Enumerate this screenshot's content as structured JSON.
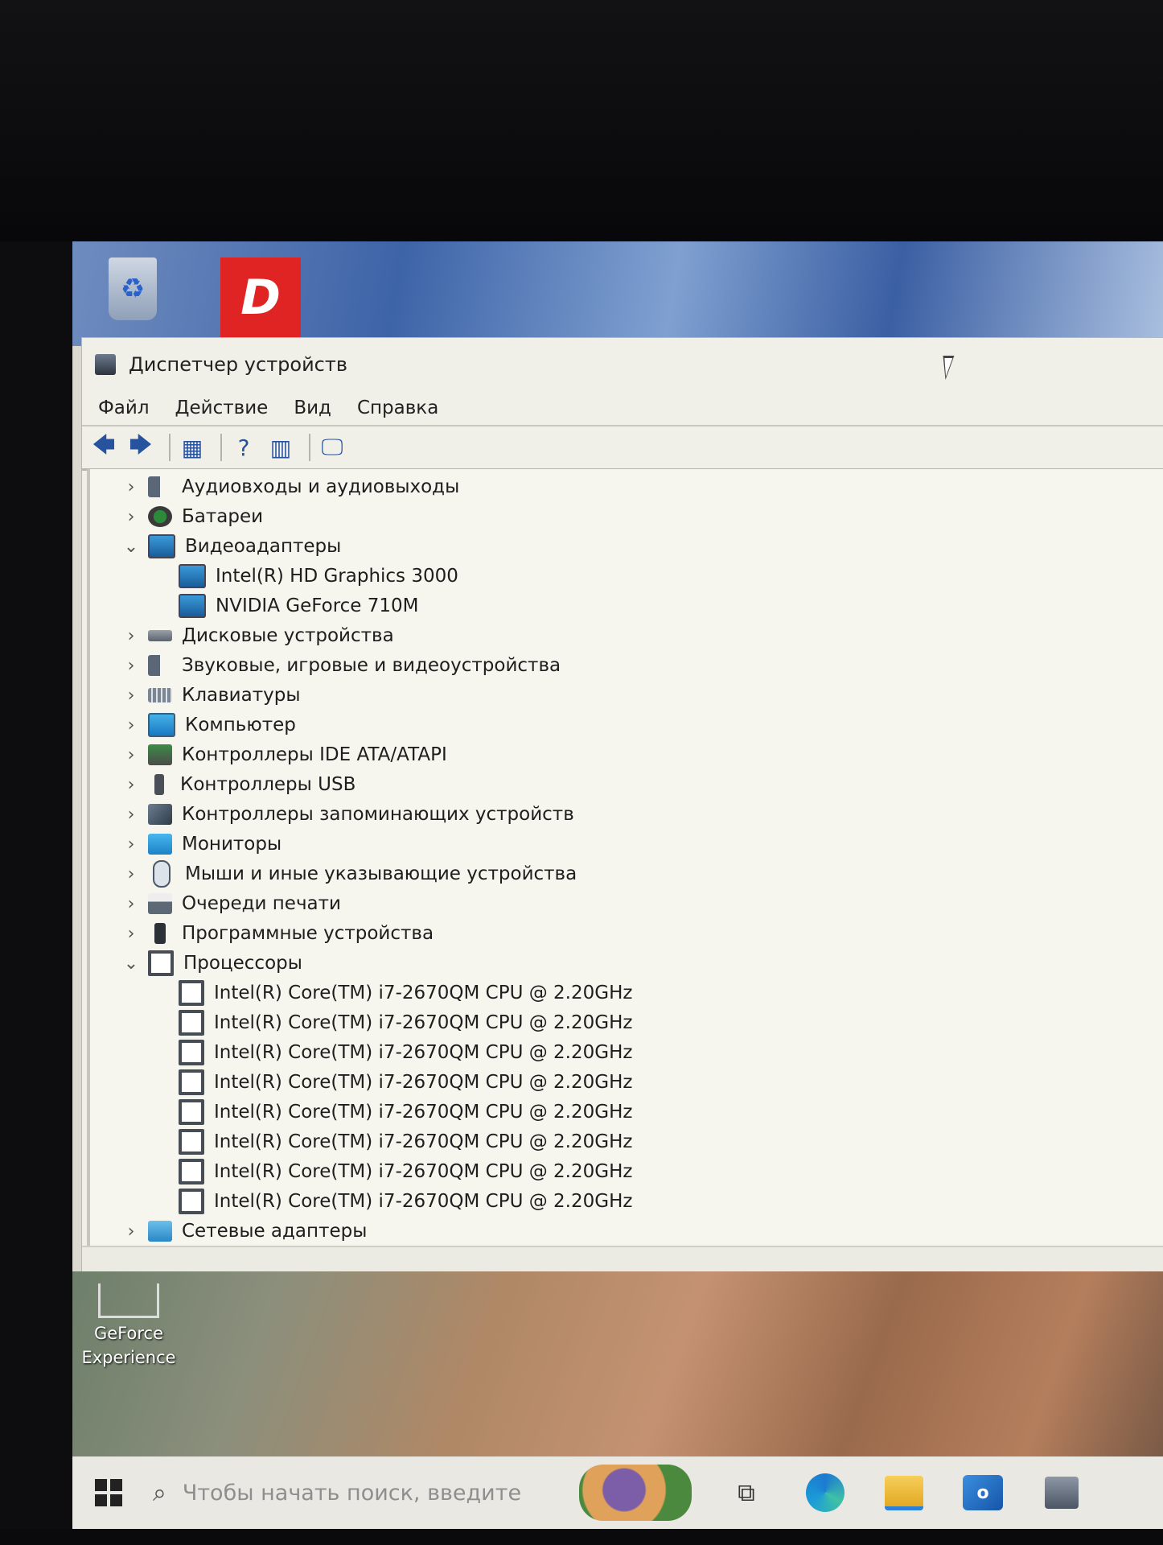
{
  "desktop": {
    "icons": [
      {
        "name": "recycle-bin",
        "label": ""
      },
      {
        "name": "d-shortcut",
        "label": ""
      },
      {
        "name": "geforce-experience",
        "label": "GeForce Experience"
      }
    ]
  },
  "window": {
    "title": "Диспетчер устройств",
    "menu": [
      "Файл",
      "Действие",
      "Вид",
      "Справка"
    ]
  },
  "tree": [
    {
      "label": "Аудиовходы и аудиовыходы",
      "expanded": false,
      "icon": "speaker-icon"
    },
    {
      "label": "Батареи",
      "expanded": false,
      "icon": "battery-icon"
    },
    {
      "label": "Видеоадаптеры",
      "expanded": true,
      "icon": "display-adapter-icon",
      "children": [
        "Intel(R) HD Graphics 3000",
        "NVIDIA GeForce 710M"
      ]
    },
    {
      "label": "Дисковые устройства",
      "expanded": false,
      "icon": "disk-drive-icon"
    },
    {
      "label": "Звуковые, игровые и видеоустройства",
      "expanded": false,
      "icon": "sound-icon"
    },
    {
      "label": "Клавиатуры",
      "expanded": false,
      "icon": "keyboard-icon"
    },
    {
      "label": "Компьютер",
      "expanded": false,
      "icon": "computer-icon"
    },
    {
      "label": "Контроллеры IDE ATA/ATAPI",
      "expanded": false,
      "icon": "ide-controller-icon"
    },
    {
      "label": "Контроллеры USB",
      "expanded": false,
      "icon": "usb-icon"
    },
    {
      "label": "Контроллеры запоминающих устройств",
      "expanded": false,
      "icon": "storage-controller-icon"
    },
    {
      "label": "Мониторы",
      "expanded": false,
      "icon": "monitor-icon"
    },
    {
      "label": "Мыши и иные указывающие устройства",
      "expanded": false,
      "icon": "mouse-icon"
    },
    {
      "label": "Очереди печати",
      "expanded": false,
      "icon": "printer-icon"
    },
    {
      "label": "Программные устройства",
      "expanded": false,
      "icon": "software-device-icon"
    },
    {
      "label": "Процессоры",
      "expanded": true,
      "icon": "processor-icon",
      "children": [
        "Intel(R) Core(TM) i7-2670QM CPU @ 2.20GHz",
        "Intel(R) Core(TM) i7-2670QM CPU @ 2.20GHz",
        "Intel(R) Core(TM) i7-2670QM CPU @ 2.20GHz",
        "Intel(R) Core(TM) i7-2670QM CPU @ 2.20GHz",
        "Intel(R) Core(TM) i7-2670QM CPU @ 2.20GHz",
        "Intel(R) Core(TM) i7-2670QM CPU @ 2.20GHz",
        "Intel(R) Core(TM) i7-2670QM CPU @ 2.20GHz",
        "Intel(R) Core(TM) i7-2670QM CPU @ 2.20GHz"
      ]
    },
    {
      "label": "Сетевые адаптеры",
      "expanded": false,
      "icon": "network-adapter-icon"
    }
  ],
  "taskbar": {
    "search_placeholder": "Чтобы начать поиск, введите"
  }
}
